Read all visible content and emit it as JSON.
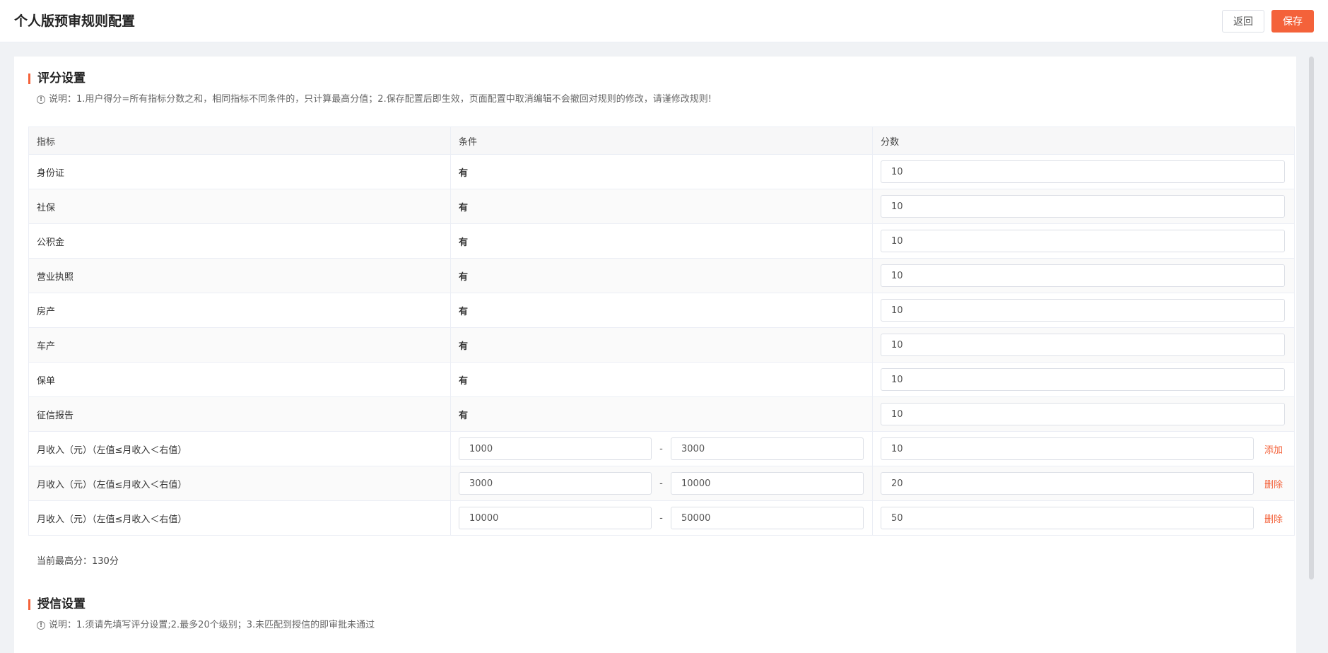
{
  "header": {
    "title": "个人版预审规则配置",
    "back_label": "返回",
    "save_label": "保存"
  },
  "scoring": {
    "title": "评分设置",
    "note": "说明：1.用户得分=所有指标分数之和，相同指标不同条件的，只计算最高分值；2.保存配置后即生效，页面配置中取消编辑不会撤回对规则的修改，请谨修改规则!",
    "columns": [
      "指标",
      "条件",
      "分数"
    ],
    "simple_rows": [
      {
        "indicator": "身份证",
        "condition": "有",
        "score": "10"
      },
      {
        "indicator": "社保",
        "condition": "有",
        "score": "10"
      },
      {
        "indicator": "公积金",
        "condition": "有",
        "score": "10"
      },
      {
        "indicator": "营业执照",
        "condition": "有",
        "score": "10"
      },
      {
        "indicator": "房产",
        "condition": "有",
        "score": "10"
      },
      {
        "indicator": "车产",
        "condition": "有",
        "score": "10"
      },
      {
        "indicator": "保单",
        "condition": "有",
        "score": "10"
      },
      {
        "indicator": "征信报告",
        "condition": "有",
        "score": "10"
      }
    ],
    "range_rows": [
      {
        "indicator": "月收入（元）（左值≤月收入＜右值）",
        "min": "1000",
        "max": "3000",
        "score": "10",
        "action": "添加"
      },
      {
        "indicator": "月收入（元）（左值≤月收入＜右值）",
        "min": "3000",
        "max": "10000",
        "score": "20",
        "action": "删除"
      },
      {
        "indicator": "月收入（元）（左值≤月收入＜右值）",
        "min": "10000",
        "max": "50000",
        "score": "50",
        "action": "删除"
      }
    ],
    "range_separator": "-",
    "max_score": "当前最高分：130分"
  },
  "credit": {
    "title": "授信设置",
    "note": "说明：1.须请先填写评分设置;2.最多20个级别；3.未匹配到授信的即审批未通过"
  },
  "icons": {
    "info": "info-circle-icon"
  },
  "colors": {
    "accent": "#f4623a",
    "background": "#f0f2f5"
  }
}
